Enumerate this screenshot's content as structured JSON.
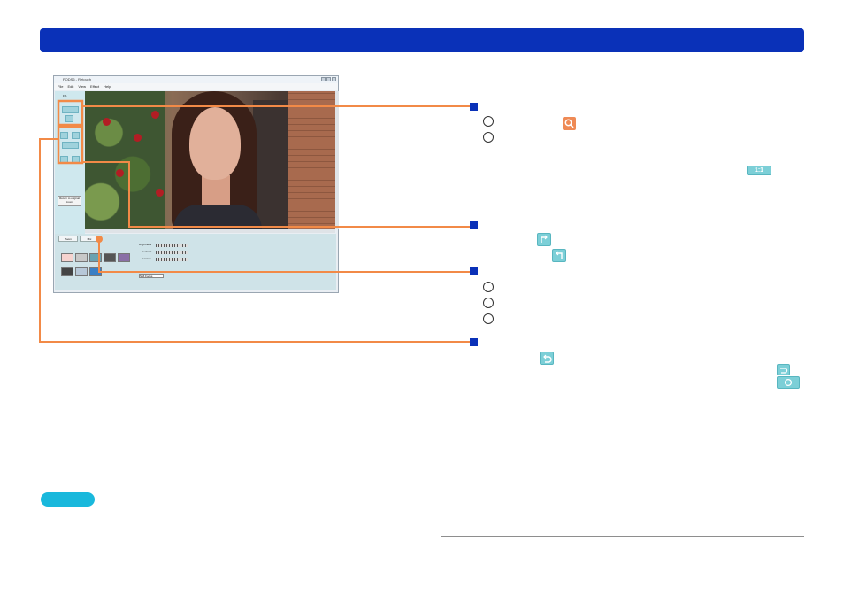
{
  "screenshot": {
    "window_title": "PODS6 - Retouch",
    "menu_items": [
      "File",
      "Edit",
      "View",
      "Effect",
      "Help"
    ],
    "left_panel_label": "1%",
    "return_button": "Return to original zoom",
    "bottom_tabs": [
      "Zoom",
      "Mix"
    ],
    "slider_labels": [
      "Brightness",
      "Contrast",
      "Gamma"
    ],
    "dropdown_value": "Soft Focus"
  },
  "icons": {
    "zoom": "magnifier-icon",
    "actual_size": "1:1",
    "rotate_left": "rotate-left-icon",
    "rotate_right": "rotate-right-icon",
    "undo": "undo-icon",
    "undo_small": "undo-small-icon",
    "refresh": "refresh-icon"
  },
  "colors": {
    "header": "#0a31b8",
    "callout": "#f28a47",
    "note": "#19b8dc",
    "marker": "#0a31b8"
  }
}
